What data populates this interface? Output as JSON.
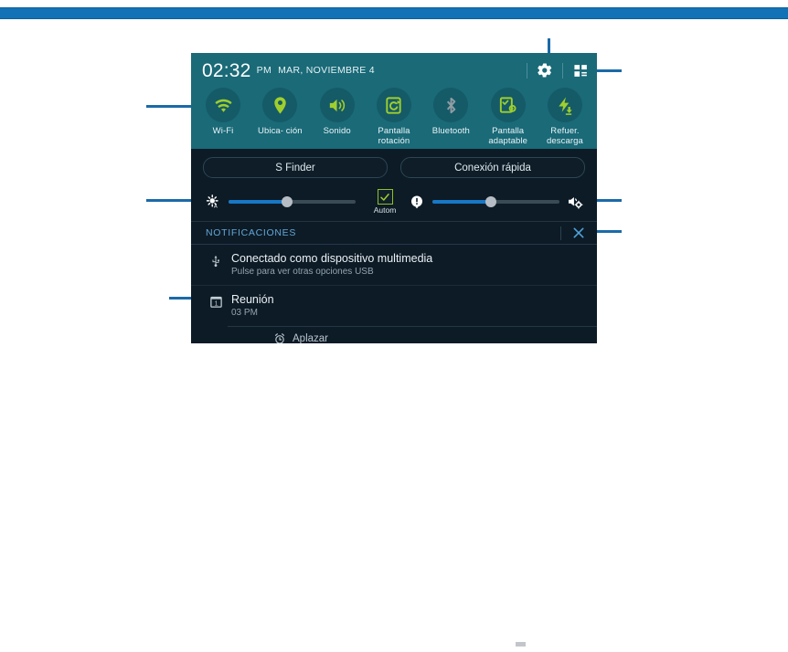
{
  "panel": {
    "status_bar": {
      "time": "02:32",
      "ampm": "PM",
      "date": "MAR, NOVIEMBRE 4",
      "settings_icon": "gear-icon",
      "quick_toggle_icon": "quick-settings-grid-icon"
    },
    "quick_toggles": [
      {
        "label": "Wi-Fi",
        "icon": "wifi-icon",
        "state": "on"
      },
      {
        "label": "Ubica-\nción",
        "icon": "location-pin-icon",
        "state": "on"
      },
      {
        "label": "Sonido",
        "icon": "sound-speaker-icon",
        "state": "on"
      },
      {
        "label": "Pantalla\nrotación",
        "icon": "screen-rotation-icon",
        "state": "on"
      },
      {
        "label": "Bluetooth",
        "icon": "bluetooth-icon",
        "state": "off"
      },
      {
        "label": "Pantalla\nadaptable",
        "icon": "adaptive-display-icon",
        "state": "on"
      },
      {
        "label": "Refuer.\ndescarga",
        "icon": "download-booster-icon",
        "state": "on"
      }
    ],
    "shortcuts": [
      {
        "label": "S Finder"
      },
      {
        "label": "Conexión rápida"
      }
    ],
    "brightness": {
      "icon": "brightness-auto-icon",
      "value_percent": 46,
      "auto_label": "Autom",
      "auto_checked": true,
      "check_icon": "checkmark-icon"
    },
    "volume": {
      "left_icon": "volume-notification-icon",
      "right_icon": "volume-settings-icon",
      "value_percent": 46
    },
    "notifications": {
      "header": "NOTIFICACIONES",
      "clear_icon": "close-x-icon",
      "items": [
        {
          "icon": "usb-icon",
          "title": "Conectado como dispositivo multimedia",
          "subtitle": "Pulse para ver otras opciones USB"
        },
        {
          "icon": "calendar-icon",
          "title": "Reunión",
          "subtitle": "03 PM",
          "action_icon": "alarm-clock-icon",
          "action_label": "Aplazar"
        }
      ]
    }
  },
  "colors": {
    "teal_header": "#1a6a78",
    "panel_bg": "#0d1b26",
    "accent_green": "#9fcf2c",
    "slider_blue": "#1878c6",
    "notif_header_blue": "#62a7d8",
    "callout_blue": "#1a6aa8",
    "top_rule_blue": "#1272b5"
  }
}
